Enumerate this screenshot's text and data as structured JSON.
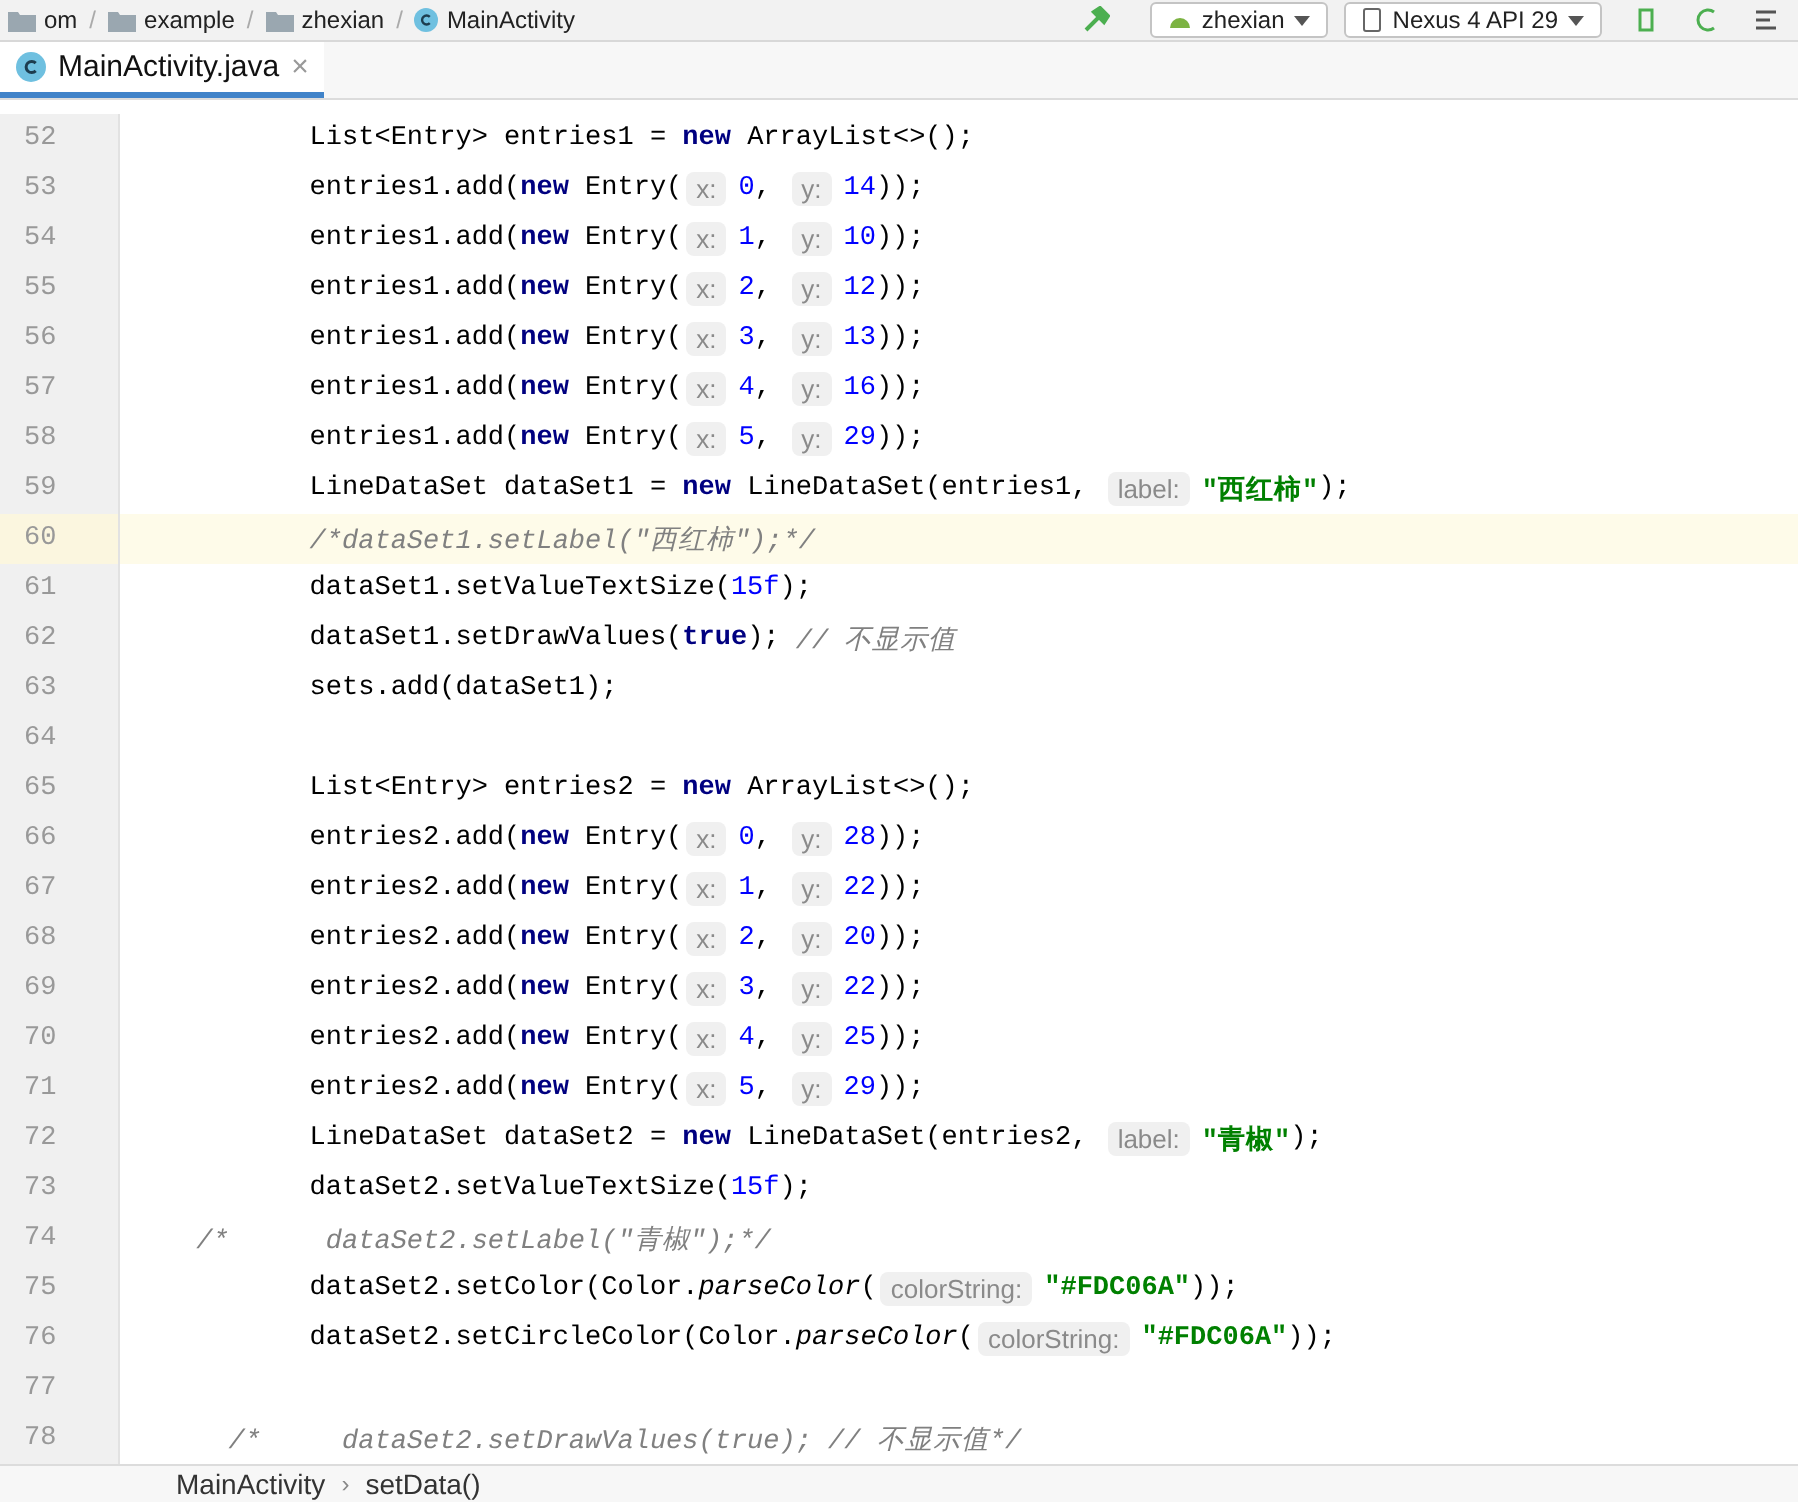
{
  "navbar": {
    "breadcrumbs": [
      {
        "kind": "folder",
        "label": "om"
      },
      {
        "kind": "folder",
        "label": "example"
      },
      {
        "kind": "folder",
        "label": "zhexian"
      },
      {
        "kind": "class",
        "label": "MainActivity"
      }
    ],
    "separator": "/",
    "run_config": "zhexian",
    "device": "Nexus 4 API 29"
  },
  "tabs": [
    {
      "label": "MainActivity.java",
      "selected": true,
      "close": "×"
    }
  ],
  "lines": [
    {
      "number": "52",
      "highlighted": false,
      "tokens": [
        {
          "kind": "plain",
          "text": "        List<Entry> entries1 = "
        },
        {
          "kind": "keyword",
          "text": "new"
        },
        {
          "kind": "plain",
          "text": " ArrayList<>();"
        }
      ]
    },
    {
      "number": "53",
      "highlighted": false,
      "tokens": [
        {
          "kind": "plain",
          "text": "        entries1.add("
        },
        {
          "kind": "keyword",
          "text": "new"
        },
        {
          "kind": "plain",
          "text": " Entry("
        },
        {
          "kind": "hint",
          "text": "x:"
        },
        {
          "kind": "number",
          "text": "0"
        },
        {
          "kind": "plain",
          "text": ", "
        },
        {
          "kind": "hint",
          "text": "y:"
        },
        {
          "kind": "number",
          "text": "14"
        },
        {
          "kind": "plain",
          "text": "));"
        }
      ]
    },
    {
      "number": "54",
      "highlighted": false,
      "tokens": [
        {
          "kind": "plain",
          "text": "        entries1.add("
        },
        {
          "kind": "keyword",
          "text": "new"
        },
        {
          "kind": "plain",
          "text": " Entry("
        },
        {
          "kind": "hint",
          "text": "x:"
        },
        {
          "kind": "number",
          "text": "1"
        },
        {
          "kind": "plain",
          "text": ", "
        },
        {
          "kind": "hint",
          "text": "y:"
        },
        {
          "kind": "number",
          "text": "10"
        },
        {
          "kind": "plain",
          "text": "));"
        }
      ]
    },
    {
      "number": "55",
      "highlighted": false,
      "tokens": [
        {
          "kind": "plain",
          "text": "        entries1.add("
        },
        {
          "kind": "keyword",
          "text": "new"
        },
        {
          "kind": "plain",
          "text": " Entry("
        },
        {
          "kind": "hint",
          "text": "x:"
        },
        {
          "kind": "number",
          "text": "2"
        },
        {
          "kind": "plain",
          "text": ", "
        },
        {
          "kind": "hint",
          "text": "y:"
        },
        {
          "kind": "number",
          "text": "12"
        },
        {
          "kind": "plain",
          "text": "));"
        }
      ]
    },
    {
      "number": "56",
      "highlighted": false,
      "tokens": [
        {
          "kind": "plain",
          "text": "        entries1.add("
        },
        {
          "kind": "keyword",
          "text": "new"
        },
        {
          "kind": "plain",
          "text": " Entry("
        },
        {
          "kind": "hint",
          "text": "x:"
        },
        {
          "kind": "number",
          "text": "3"
        },
        {
          "kind": "plain",
          "text": ", "
        },
        {
          "kind": "hint",
          "text": "y:"
        },
        {
          "kind": "number",
          "text": "13"
        },
        {
          "kind": "plain",
          "text": "));"
        }
      ]
    },
    {
      "number": "57",
      "highlighted": false,
      "tokens": [
        {
          "kind": "plain",
          "text": "        entries1.add("
        },
        {
          "kind": "keyword",
          "text": "new"
        },
        {
          "kind": "plain",
          "text": " Entry("
        },
        {
          "kind": "hint",
          "text": "x:"
        },
        {
          "kind": "number",
          "text": "4"
        },
        {
          "kind": "plain",
          "text": ", "
        },
        {
          "kind": "hint",
          "text": "y:"
        },
        {
          "kind": "number",
          "text": "16"
        },
        {
          "kind": "plain",
          "text": "));"
        }
      ]
    },
    {
      "number": "58",
      "highlighted": false,
      "tokens": [
        {
          "kind": "plain",
          "text": "        entries1.add("
        },
        {
          "kind": "keyword",
          "text": "new"
        },
        {
          "kind": "plain",
          "text": " Entry("
        },
        {
          "kind": "hint",
          "text": "x:"
        },
        {
          "kind": "number",
          "text": "5"
        },
        {
          "kind": "plain",
          "text": ", "
        },
        {
          "kind": "hint",
          "text": "y:"
        },
        {
          "kind": "number",
          "text": "29"
        },
        {
          "kind": "plain",
          "text": "));"
        }
      ]
    },
    {
      "number": "59",
      "highlighted": false,
      "tokens": [
        {
          "kind": "plain",
          "text": "        LineDataSet dataSet1 = "
        },
        {
          "kind": "keyword",
          "text": "new"
        },
        {
          "kind": "plain",
          "text": " LineDataSet(entries1, "
        },
        {
          "kind": "hint",
          "text": "label:"
        },
        {
          "kind": "string",
          "text": "\"西红柿\""
        },
        {
          "kind": "plain",
          "text": ");"
        }
      ]
    },
    {
      "number": "60",
      "highlighted": true,
      "tokens": [
        {
          "kind": "comment",
          "text": "        /*dataSet1.setLabel(\"西红柿\");*/"
        }
      ]
    },
    {
      "number": "61",
      "highlighted": false,
      "tokens": [
        {
          "kind": "plain",
          "text": "        dataSet1.setValueTextSize("
        },
        {
          "kind": "number",
          "text": "15f"
        },
        {
          "kind": "plain",
          "text": ");"
        }
      ]
    },
    {
      "number": "62",
      "highlighted": false,
      "tokens": [
        {
          "kind": "plain",
          "text": "        dataSet1.setDrawValues("
        },
        {
          "kind": "keyword",
          "text": "true"
        },
        {
          "kind": "plain",
          "text": "); "
        },
        {
          "kind": "comment",
          "text": "// 不显示值"
        }
      ]
    },
    {
      "number": "63",
      "highlighted": false,
      "tokens": [
        {
          "kind": "plain",
          "text": "        sets.add(dataSet1);"
        }
      ]
    },
    {
      "number": "64",
      "highlighted": false
    },
    {
      "number": "65",
      "highlighted": false,
      "tokens": [
        {
          "kind": "plain",
          "text": "        List<Entry> entries2 = "
        },
        {
          "kind": "keyword",
          "text": "new"
        },
        {
          "kind": "plain",
          "text": " ArrayList<>();"
        }
      ]
    },
    {
      "number": "66",
      "highlighted": false,
      "tokens": [
        {
          "kind": "plain",
          "text": "        entries2.add("
        },
        {
          "kind": "keyword",
          "text": "new"
        },
        {
          "kind": "plain",
          "text": " Entry("
        },
        {
          "kind": "hint",
          "text": "x:"
        },
        {
          "kind": "number",
          "text": "0"
        },
        {
          "kind": "plain",
          "text": ", "
        },
        {
          "kind": "hint",
          "text": "y:"
        },
        {
          "kind": "number",
          "text": "28"
        },
        {
          "kind": "plain",
          "text": "));"
        }
      ]
    },
    {
      "number": "67",
      "highlighted": false,
      "tokens": [
        {
          "kind": "plain",
          "text": "        entries2.add("
        },
        {
          "kind": "keyword",
          "text": "new"
        },
        {
          "kind": "plain",
          "text": " Entry("
        },
        {
          "kind": "hint",
          "text": "x:"
        },
        {
          "kind": "number",
          "text": "1"
        },
        {
          "kind": "plain",
          "text": ", "
        },
        {
          "kind": "hint",
          "text": "y:"
        },
        {
          "kind": "number",
          "text": "22"
        },
        {
          "kind": "plain",
          "text": "));"
        }
      ]
    },
    {
      "number": "68",
      "highlighted": false,
      "tokens": [
        {
          "kind": "plain",
          "text": "        entries2.add("
        },
        {
          "kind": "keyword",
          "text": "new"
        },
        {
          "kind": "plain",
          "text": " Entry("
        },
        {
          "kind": "hint",
          "text": "x:"
        },
        {
          "kind": "number",
          "text": "2"
        },
        {
          "kind": "plain",
          "text": ", "
        },
        {
          "kind": "hint",
          "text": "y:"
        },
        {
          "kind": "number",
          "text": "20"
        },
        {
          "kind": "plain",
          "text": "));"
        }
      ]
    },
    {
      "number": "69",
      "highlighted": false,
      "tokens": [
        {
          "kind": "plain",
          "text": "        entries2.add("
        },
        {
          "kind": "keyword",
          "text": "new"
        },
        {
          "kind": "plain",
          "text": " Entry("
        },
        {
          "kind": "hint",
          "text": "x:"
        },
        {
          "kind": "number",
          "text": "3"
        },
        {
          "kind": "plain",
          "text": ", "
        },
        {
          "kind": "hint",
          "text": "y:"
        },
        {
          "kind": "number",
          "text": "22"
        },
        {
          "kind": "plain",
          "text": "));"
        }
      ]
    },
    {
      "number": "70",
      "highlighted": false,
      "tokens": [
        {
          "kind": "plain",
          "text": "        entries2.add("
        },
        {
          "kind": "keyword",
          "text": "new"
        },
        {
          "kind": "plain",
          "text": " Entry("
        },
        {
          "kind": "hint",
          "text": "x:"
        },
        {
          "kind": "number",
          "text": "4"
        },
        {
          "kind": "plain",
          "text": ", "
        },
        {
          "kind": "hint",
          "text": "y:"
        },
        {
          "kind": "number",
          "text": "25"
        },
        {
          "kind": "plain",
          "text": "));"
        }
      ]
    },
    {
      "number": "71",
      "highlighted": false,
      "tokens": [
        {
          "kind": "plain",
          "text": "        entries2.add("
        },
        {
          "kind": "keyword",
          "text": "new"
        },
        {
          "kind": "plain",
          "text": " Entry("
        },
        {
          "kind": "hint",
          "text": "x:"
        },
        {
          "kind": "number",
          "text": "5"
        },
        {
          "kind": "plain",
          "text": ", "
        },
        {
          "kind": "hint",
          "text": "y:"
        },
        {
          "kind": "number",
          "text": "29"
        },
        {
          "kind": "plain",
          "text": "));"
        }
      ]
    },
    {
      "number": "72",
      "highlighted": false,
      "tokens": [
        {
          "kind": "plain",
          "text": "        LineDataSet dataSet2 = "
        },
        {
          "kind": "keyword",
          "text": "new"
        },
        {
          "kind": "plain",
          "text": " LineDataSet(entries2, "
        },
        {
          "kind": "hint",
          "text": "label:"
        },
        {
          "kind": "string",
          "text": "\"青椒\""
        },
        {
          "kind": "plain",
          "text": ");"
        }
      ]
    },
    {
      "number": "73",
      "highlighted": false,
      "tokens": [
        {
          "kind": "plain",
          "text": "        dataSet2.setValueTextSize("
        },
        {
          "kind": "number",
          "text": "15f"
        },
        {
          "kind": "plain",
          "text": ");"
        }
      ]
    },
    {
      "number": "74",
      "highlighted": false,
      "tokens": [
        {
          "kind": "comment",
          "text": " /*      dataSet2.setLabel(\"青椒\");*/"
        }
      ]
    },
    {
      "number": "75",
      "highlighted": false,
      "tokens": [
        {
          "kind": "plain",
          "text": "        dataSet2.setColor(Color."
        },
        {
          "kind": "italic",
          "text": "parseColor"
        },
        {
          "kind": "plain",
          "text": "("
        },
        {
          "kind": "hint",
          "text": "colorString:"
        },
        {
          "kind": "string",
          "text": "\"#FDC06A\""
        },
        {
          "kind": "plain",
          "text": "));"
        }
      ]
    },
    {
      "number": "76",
      "highlighted": false,
      "tokens": [
        {
          "kind": "plain",
          "text": "        dataSet2.setCircleColor(Color."
        },
        {
          "kind": "italic",
          "text": "parseColor"
        },
        {
          "kind": "plain",
          "text": "("
        },
        {
          "kind": "hint",
          "text": "colorString:"
        },
        {
          "kind": "string",
          "text": "\"#FDC06A\""
        },
        {
          "kind": "plain",
          "text": "));"
        }
      ]
    },
    {
      "number": "77",
      "highlighted": false
    },
    {
      "number": "78",
      "highlighted": false,
      "tokens": [
        {
          "kind": "comment",
          "text": "   /*     dataSet2.setDrawValues(true); // 不显示值*/"
        }
      ]
    }
  ],
  "status_breadcrumbs": {
    "items": [
      "MainActivity",
      "setData()"
    ],
    "separator": "›"
  }
}
